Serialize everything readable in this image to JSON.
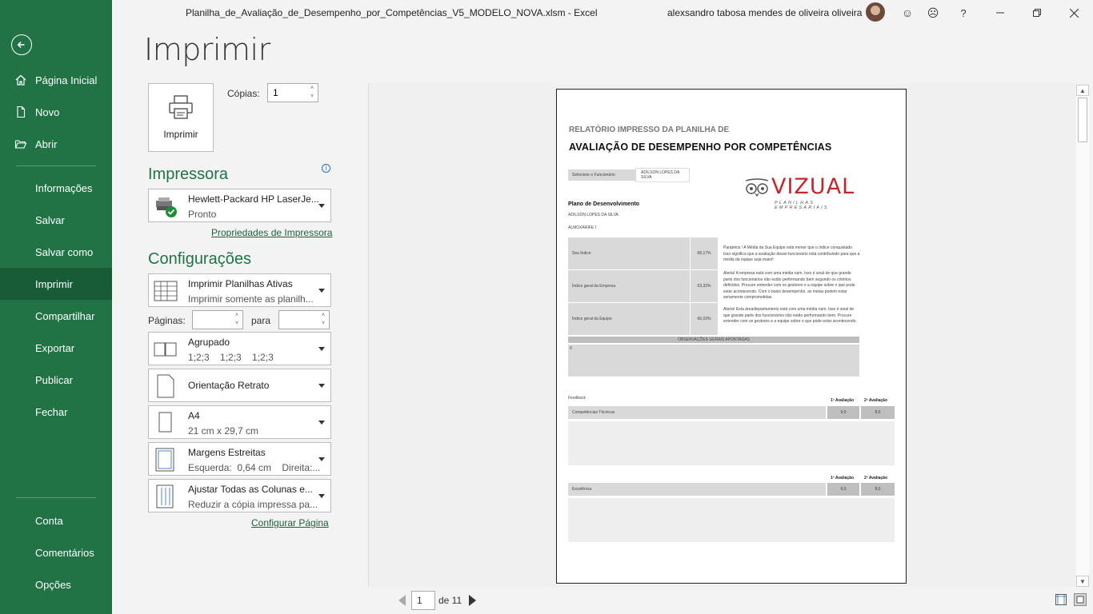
{
  "window": {
    "title": "Planilha_de_Avaliação_de_Desempenho_por_Competências_V5_MODELO_NOVA.xlsm  -  Excel",
    "user": "alexsandro tabosa mendes de oliveira oliveira"
  },
  "sidebar": {
    "items": [
      {
        "label": "Página Inicial",
        "icon": "home-icon"
      },
      {
        "label": "Novo",
        "icon": "new-document-icon"
      },
      {
        "label": "Abrir",
        "icon": "folder-open-icon"
      },
      {
        "label": "Informações"
      },
      {
        "label": "Salvar"
      },
      {
        "label": "Salvar como"
      },
      {
        "label": "Imprimir",
        "active": true
      },
      {
        "label": "Compartilhar"
      },
      {
        "label": "Exportar"
      },
      {
        "label": "Publicar"
      },
      {
        "label": "Fechar"
      },
      {
        "label": "Conta"
      },
      {
        "label": "Comentários"
      },
      {
        "label": "Opções"
      }
    ]
  },
  "print": {
    "heading": "Imprimir",
    "button_label": "Imprimir",
    "copies_label": "Cópias:",
    "copies_value": "1",
    "printer_section": "Impressora",
    "printer_name": "Hewlett-Packard HP LaserJe...",
    "printer_status": "Pronto",
    "printer_props_link": "Propriedades de Impressora",
    "settings_section": "Configurações",
    "what_l1": "Imprimir Planilhas Ativas",
    "what_l2": "Imprimir somente as planilh...",
    "pages_label": "Páginas:",
    "to_label": "para",
    "collate_l1": "Agrupado",
    "collate_l2": "1;2;3    1;2;3    1;2;3",
    "orientation_l1": "Orientação Retrato",
    "paper_l1": "A4",
    "paper_l2": "21 cm x 29,7 cm",
    "margins_l1": "Margens Estreitas",
    "margins_l2": "Esquerda:  0,64 cm    Direita:...",
    "scaling_l1": "Ajustar Todas as Colunas e...",
    "scaling_l2": "Reduzir a cópia impressa pa...",
    "page_setup_link": "Configurar Página"
  },
  "preview": {
    "subtitle": "RELATÓRIO IMPRESSO DA PLANILHA DE",
    "title": "AVALIAÇÃO DE DESEMPENHO POR COMPETÊNCIAS",
    "field_label": "Selecione o Funcionário",
    "field_value": "ADILSON LOPES DA SILVA",
    "brand": "VIZUAL",
    "brand_tag": "PLANILHAS EMPRESARIAIS",
    "plan_heading": "Plano de Desenvolvimento",
    "plan_name": "ADILSON LOPES DA SILVA",
    "plan_role": "ALMOXARIFE I",
    "rows": [
      {
        "label": "Seu Índice",
        "value": "68,17%",
        "msg": "Parabéns ! A Média da Sua Equipe está menor que o índice conquistado. Isso significa que a avaliação desse funcionário está contribuindo para que a média da equipe seja maior!"
      },
      {
        "label": "Índice geral da Empresa",
        "value": "63,33%",
        "msg": "Alerta! A empresa está com uma média ruim. Isso é sinal de que grande parte dos funcionários não estão performando bem segundo os critérios definidos. Procure entender com os gestores e a equipe sobre o que pode estar acontecendo. Com o baixo desempenho, as metas podem estar seriamente comprometidas."
      },
      {
        "label": "Índice geral da Equipe",
        "value": "66,03%",
        "msg": "Alerta! Esta área/departamento está com uma média ruim. Isso é sinal de que grande parte dos funcionários não estão performando bem. Procure entender com os gestores e a equipe sobre o que pode estar acontecendo."
      }
    ],
    "obs_label": "OBSERVAÇÕES GERAIS APONTADAS",
    "obs_value": "0",
    "feedback_label": "Feedback",
    "eval1": "1ª Avaliação",
    "eval2": "2ª Avaliação",
    "comp1": "Competências Técnicas",
    "comp1_v1": "9,0",
    "comp1_v2": "8,0",
    "comp2": "Excelência",
    "comp2_v1": "9,0",
    "comp2_v2": "8,0"
  },
  "pager": {
    "current": "1",
    "of": "de 11"
  },
  "colors": {
    "accent": "#217346",
    "sidebar_active": "#185c37",
    "brand": "#c0282d"
  }
}
